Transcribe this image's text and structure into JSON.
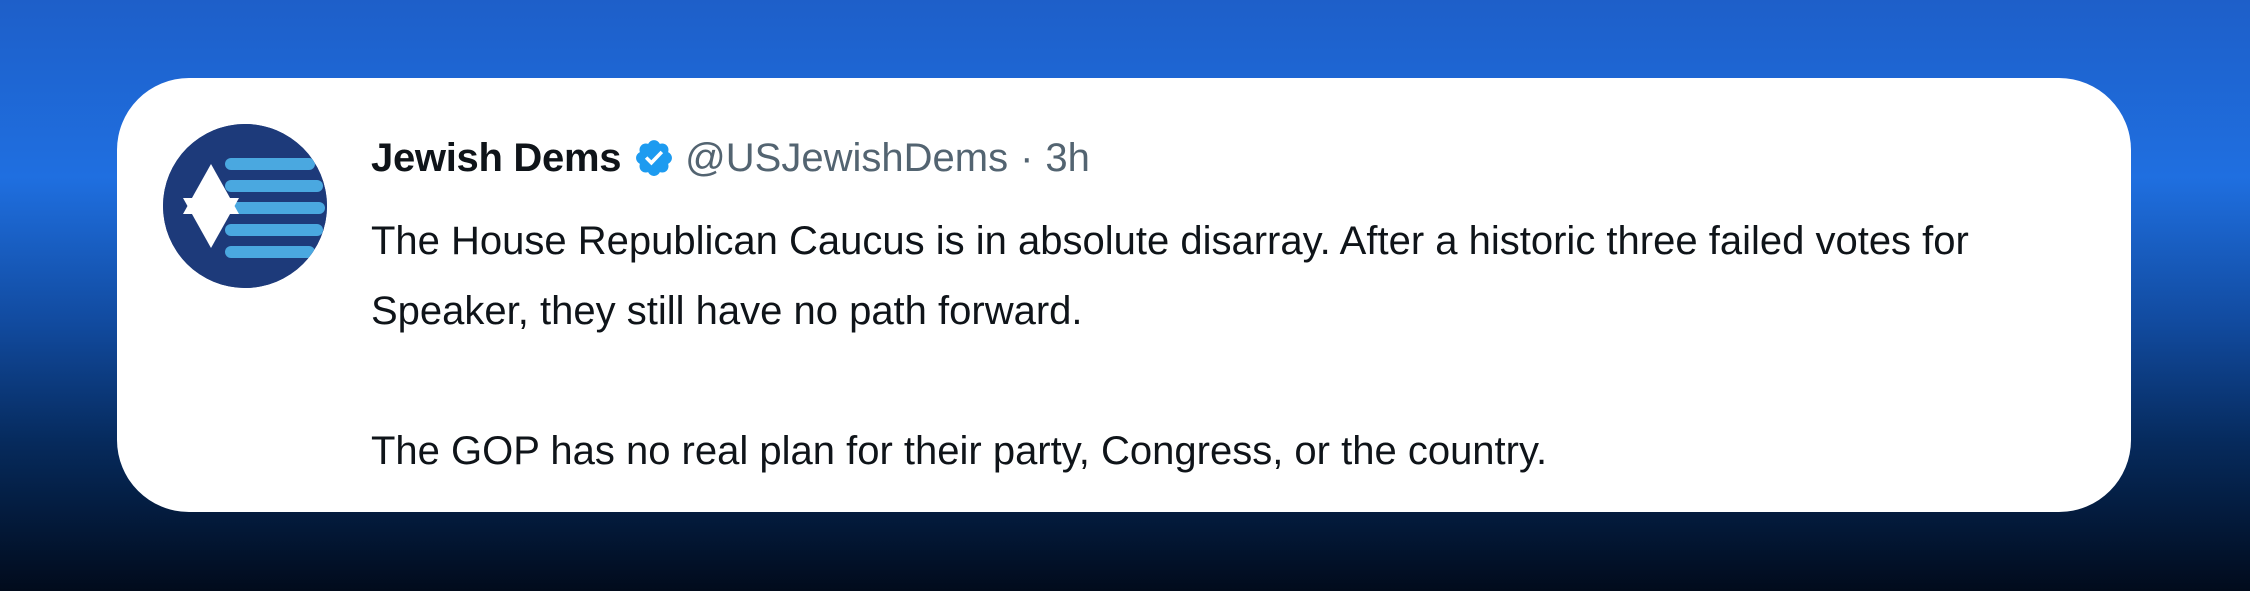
{
  "tweet": {
    "display_name": "Jewish Dems",
    "handle": "@USJewishDems",
    "separator": "·",
    "time": "3h",
    "verified": true,
    "avatar_icon": "star-of-david-stripes-logo",
    "paragraphs": [
      "The House Republican Caucus is in absolute disarray. After a historic three failed votes for Speaker, they still have no path forward.",
      "The GOP has no real plan for their party, Congress, or the country."
    ]
  },
  "colors": {
    "verified_badge": "#1d9bf0",
    "text_primary": "#0f1419",
    "text_secondary": "#536471",
    "avatar_bg": "#1d3a7a",
    "avatar_stripes": "#4aa8e0"
  }
}
